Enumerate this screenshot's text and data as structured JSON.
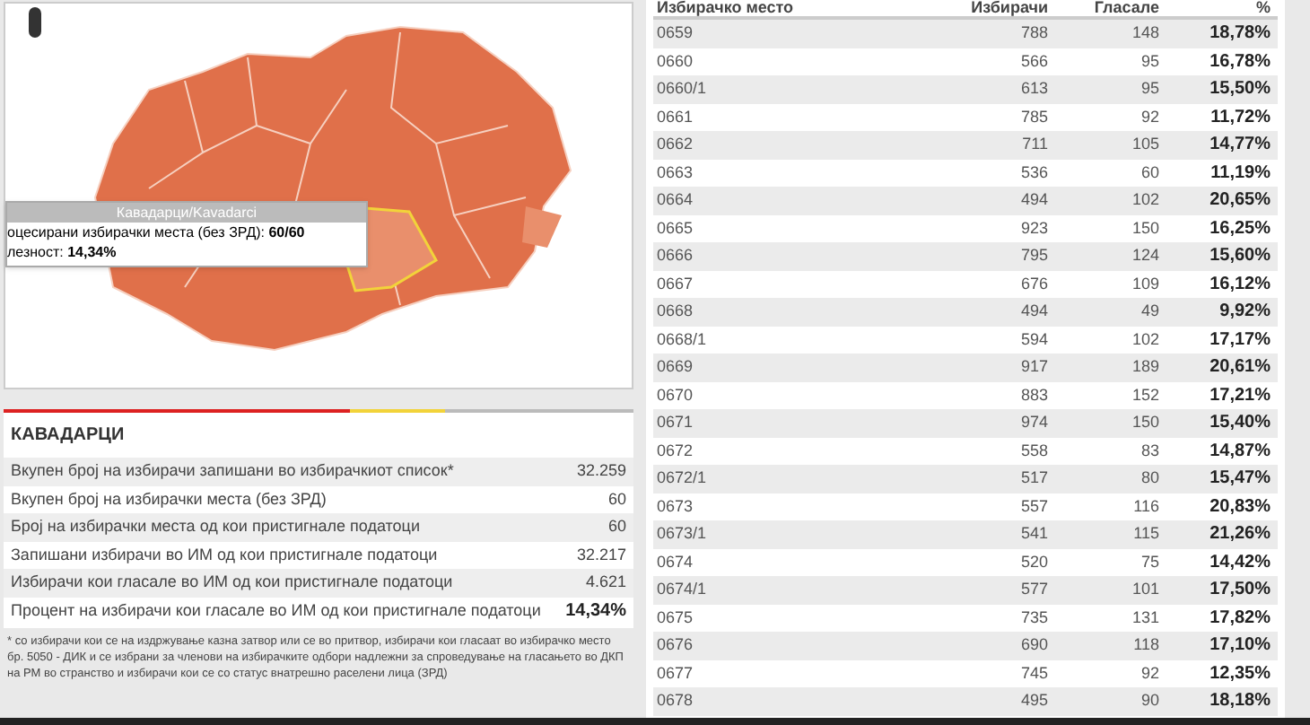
{
  "map": {
    "tooltip": {
      "title": "Кавадарци/Kavadarci",
      "lines": [
        "оцесирани избирачки места (без ЗРД): **60/60**",
        "лезност: **14,34%**"
      ]
    }
  },
  "summary": {
    "title": "КАВАДАРЦИ",
    "rows": [
      {
        "label": "Вкупен број на избирачи запишани во избирачкиот список*",
        "value": "32.259",
        "bold": false
      },
      {
        "label": "Вкупен број на избирачки места (без ЗРД)",
        "value": "60",
        "bold": false
      },
      {
        "label": "Број на избирачки места од кои пристигнале податоци",
        "value": "60",
        "bold": false
      },
      {
        "label": "Запишани избирачи во ИМ од кои пристигнале податоци",
        "value": "32.217",
        "bold": false
      },
      {
        "label": "Избирачи кои гласале во ИМ од кои пристигнале податоци",
        "value": "4.621",
        "bold": false
      },
      {
        "label": "Процент на избирачи кои гласале во ИМ од кои пристигнале податоци",
        "value": "14,34%",
        "bold": true
      }
    ],
    "footnote": "* со избирачи кои се на издржување казна затвор или се во притвор, избирачи кои гласаат во избирачко место бр. 5050 - ДИК и се избрани за членови на избирачките одбори надлежни за спроведување на гласањето во ДКП на РМ во странство и избирачи кои се со статус внатрешно раселени лица (ЗРД)"
  },
  "table": {
    "columns": [
      "Избирачко место",
      "Избирачи",
      "Гласале",
      "%"
    ],
    "rows": [
      [
        "0659",
        "788",
        "148",
        "18,78%"
      ],
      [
        "0660",
        "566",
        "95",
        "16,78%"
      ],
      [
        "0660/1",
        "613",
        "95",
        "15,50%"
      ],
      [
        "0661",
        "785",
        "92",
        "11,72%"
      ],
      [
        "0662",
        "711",
        "105",
        "14,77%"
      ],
      [
        "0663",
        "536",
        "60",
        "11,19%"
      ],
      [
        "0664",
        "494",
        "102",
        "20,65%"
      ],
      [
        "0665",
        "923",
        "150",
        "16,25%"
      ],
      [
        "0666",
        "795",
        "124",
        "15,60%"
      ],
      [
        "0667",
        "676",
        "109",
        "16,12%"
      ],
      [
        "0668",
        "494",
        "49",
        "9,92%"
      ],
      [
        "0668/1",
        "594",
        "102",
        "17,17%"
      ],
      [
        "0669",
        "917",
        "189",
        "20,61%"
      ],
      [
        "0670",
        "883",
        "152",
        "17,21%"
      ],
      [
        "0671",
        "974",
        "150",
        "15,40%"
      ],
      [
        "0672",
        "558",
        "83",
        "14,87%"
      ],
      [
        "0672/1",
        "517",
        "80",
        "15,47%"
      ],
      [
        "0673",
        "557",
        "116",
        "20,83%"
      ],
      [
        "0673/1",
        "541",
        "115",
        "21,26%"
      ],
      [
        "0674",
        "520",
        "75",
        "14,42%"
      ],
      [
        "0674/1",
        "577",
        "101",
        "17,50%"
      ],
      [
        "0675",
        "735",
        "131",
        "17,82%"
      ],
      [
        "0676",
        "690",
        "118",
        "17,10%"
      ],
      [
        "0677",
        "745",
        "92",
        "12,35%"
      ],
      [
        "0678",
        "495",
        "90",
        "18,18%"
      ]
    ]
  }
}
